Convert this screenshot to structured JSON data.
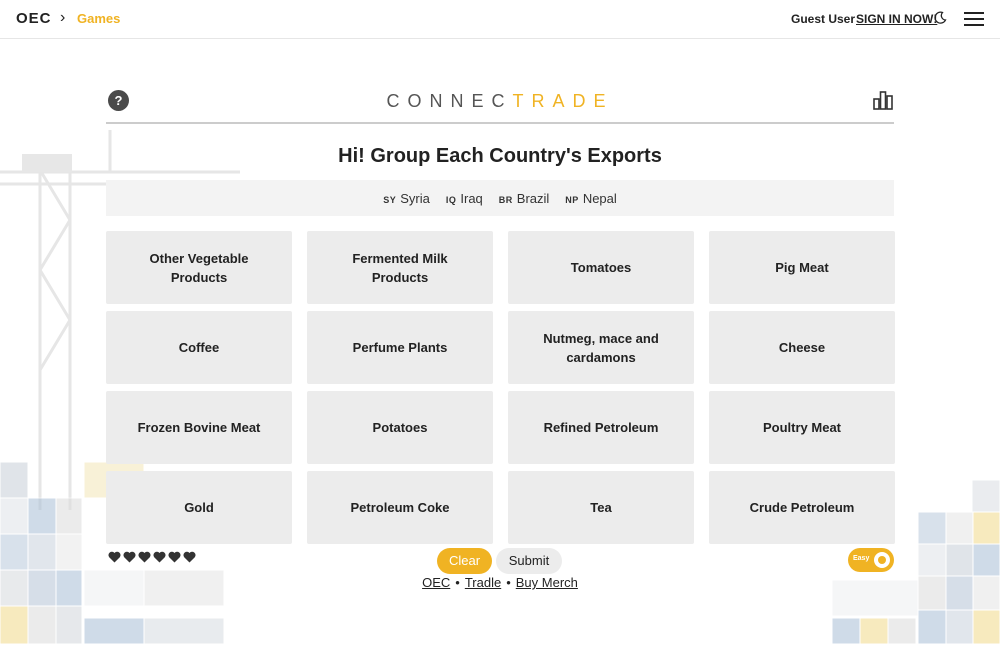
{
  "nav": {
    "logo": "OEC",
    "breadcrumb_sep": "›",
    "breadcrumb": "Games",
    "user": "Guest User",
    "signin": "SIGN IN NOW!"
  },
  "game": {
    "help": "?",
    "brand_part1": "CONN",
    "brand_part2": "E",
    "brand_part3": "C",
    "brand_part4": "TRADE",
    "headline": "Hi! Group Each Country's Exports",
    "countries": [
      {
        "code": "SY",
        "name": "Syria"
      },
      {
        "code": "IQ",
        "name": "Iraq"
      },
      {
        "code": "BR",
        "name": "Brazil"
      },
      {
        "code": "NP",
        "name": "Nepal"
      }
    ],
    "tiles": [
      "Other Vegetable Products",
      "Fermented Milk Products",
      "Tomatoes",
      "Pig Meat",
      "Coffee",
      "Perfume Plants",
      "Nutmeg, mace and cardamons",
      "Cheese",
      "Frozen Bovine Meat",
      "Potatoes",
      "Refined Petroleum",
      "Poultry Meat",
      "Gold",
      "Petroleum Coke",
      "Tea",
      "Crude Petroleum"
    ],
    "lives_remaining": 6,
    "clear_label": "Clear",
    "submit_label": "Submit",
    "links": [
      "OEC",
      "Tradle",
      "Buy Merch"
    ],
    "link_separator": "•",
    "difficulty_label": "Easy"
  },
  "colors": {
    "accent": "#f0b323",
    "tile": "#ececec",
    "dark": "#222222"
  },
  "icons": [
    "chevron-right-icon",
    "moon-icon",
    "hamburger-menu-icon",
    "help-icon",
    "stats-bar-chart-icon",
    "heart-icon"
  ]
}
